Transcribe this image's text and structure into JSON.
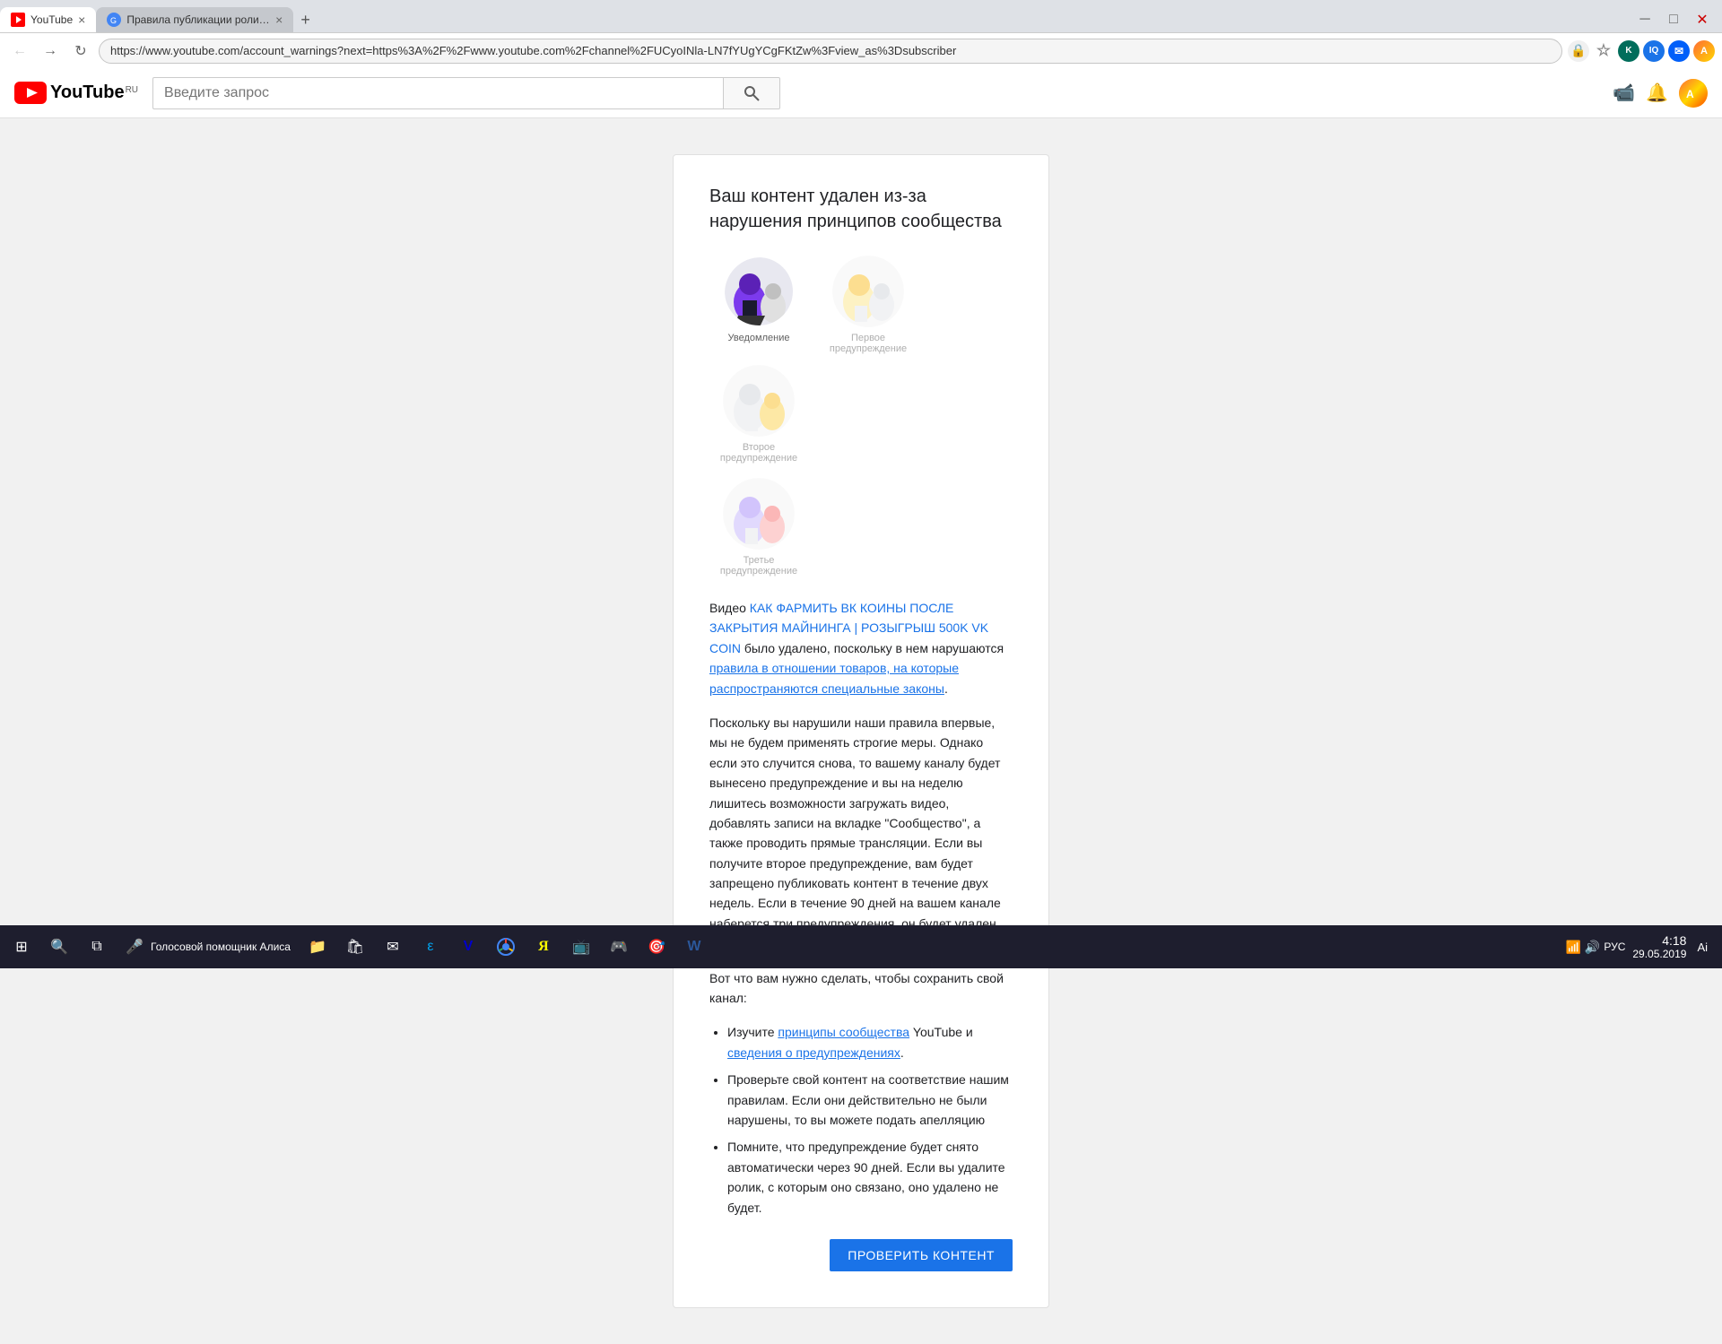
{
  "browser": {
    "tab1_title": "YouTube",
    "tab2_title": "Правила публикации роликов ...",
    "address": "https://www.youtube.com/account_warnings?next=https%3A%2F%2Fwww.youtube.com%2Fchannel%2FUCyoINla-LN7fYUgYCgFKtZw%3Fview_as%3Dsubscriber",
    "new_tab_label": "+"
  },
  "youtube": {
    "logo_text": "YouTube",
    "logo_ru": "RU",
    "search_placeholder": "Введите запрос"
  },
  "card": {
    "title": "Ваш контент удален из-за нарушения принципов сообщества",
    "step1_label": "Уведомление",
    "step2_label": "Первое предупреждение",
    "step3_label": "Второе предупреждение",
    "step4_label": "Третье предупреждение",
    "video_link": "КАК ФАРМИТЬ ВК КОИНЫ ПОСЛЕ ЗАКРЫТИЯ МАЙНИНГА | РОЗЫГРЫШ 500K VK COIN",
    "text_before_link": "Видео ",
    "text_was_deleted": " было удалено, поскольку в нем нарушаются ",
    "rules_link": "правила в отношении товаров, на которые распространяются специальные законы",
    "paragraph1": "Поскольку вы нарушили наши правила впервые, мы не будем применять строгие меры. Однако если это случится снова, то вашему каналу будет вынесено предупреждение и вы на неделю лишитесь возможности загружать видео, добавлять записи на вкладке \"Сообщество\", а также проводить прямые трансляции. Если вы получите второе предупреждение, вам будет запрещено публиковать контент в течение двух недель. Если в течение 90 дней на вашем канале наберется три предупреждения, он будет удален без возможности восстановления.",
    "what_to_do": "Вот что вам нужно сделать, чтобы сохранить свой канал:",
    "bullet1_prefix": "Изучите ",
    "bullet1_link1": "принципы сообщества",
    "bullet1_middle": " YouTube и ",
    "bullet1_link2": "сведения о предупреждениях",
    "bullet1_suffix": ".",
    "bullet2": "Проверьте свой контент на соответствие нашим правилам. Если они действительно не были нарушены, то вы можете подать апелляцию",
    "bullet3": "Помните, что предупреждение будет снято автоматически через 90 дней. Если вы удалите ролик, с которым оно связано, оно удалено не будет.",
    "check_btn": "ПРОВЕРИТЬ КОНТЕНТ"
  },
  "taskbar": {
    "start_icon": "⊞",
    "search_icon": "🔍",
    "task_view": "⧉",
    "voice_assistant": "Голосовой помощник Алиса",
    "time": "4:18",
    "date": "29.05.2019",
    "lang": "РУС",
    "ai_label": "Ai"
  }
}
